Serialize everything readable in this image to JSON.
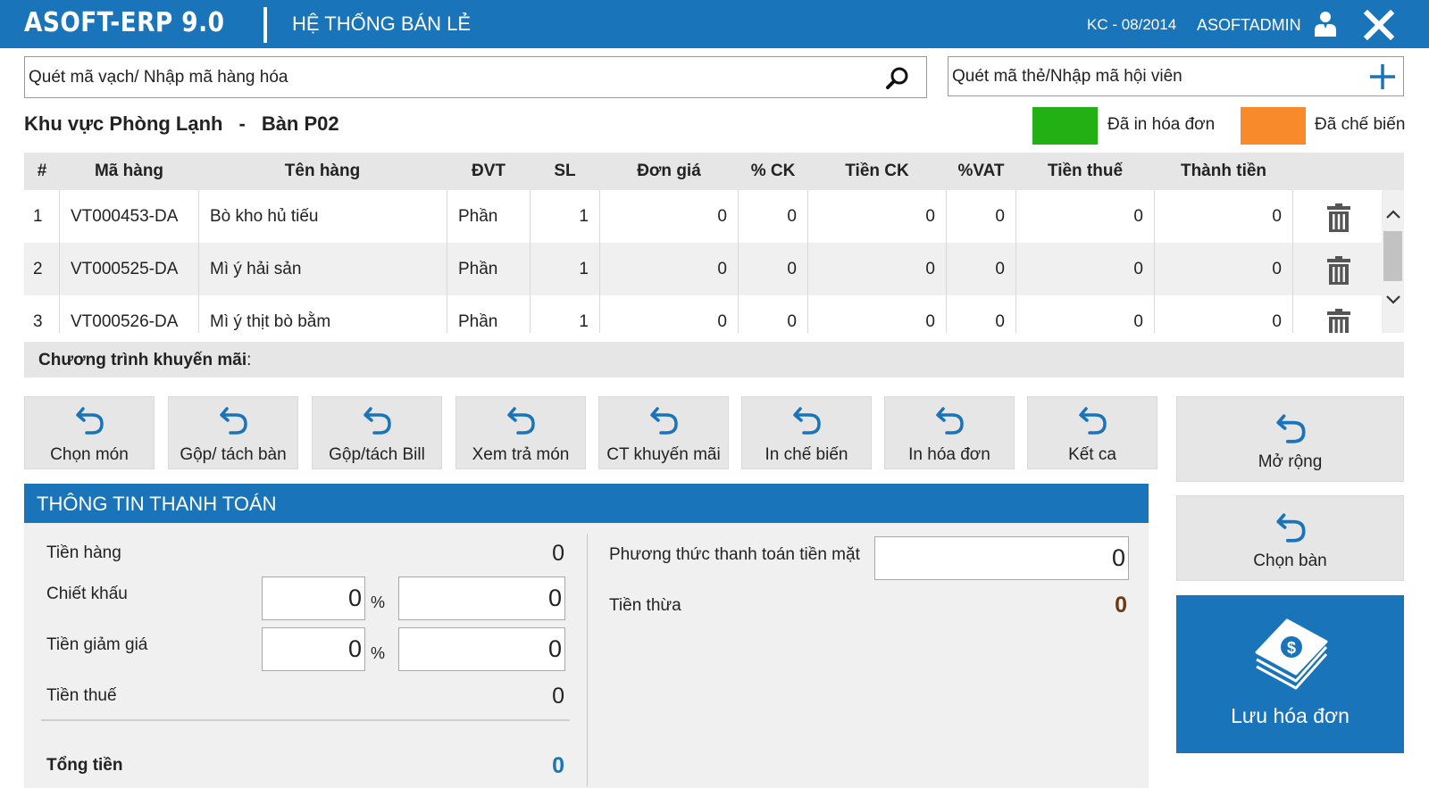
{
  "header": {
    "logo": "ASOFT-ERP 9.0",
    "system_title": "HỆ THỐNG BÁN LẺ",
    "period": "KC - 08/2014",
    "username": "ASOFTADMIN",
    "colors": {
      "primary": "#1a74b9"
    }
  },
  "search": {
    "product_placeholder": "Quét mã vạch/ Nhập mã hàng hóa",
    "member_placeholder": "Quét mã thẻ/Nhập mã hội viên"
  },
  "location": {
    "area": "Khu vực Phòng Lạnh",
    "separator": "-",
    "table": "Bàn P02"
  },
  "legend": {
    "printed_label": "Đã in hóa đơn",
    "printed_color": "#22b014",
    "processed_label": "Đã chế biến",
    "processed_color": "#f98a2c"
  },
  "table": {
    "columns": [
      "#",
      "Mã hàng",
      "Tên hàng",
      "ĐVT",
      "SL",
      "Đơn giá",
      "% CK",
      "Tiền CK",
      "%VAT",
      "Tiền thuế",
      "Thành tiền"
    ],
    "rows": [
      {
        "no": "1",
        "code": "VT000453-DA",
        "name": "Bò kho hủ tiếu",
        "unit": "Phần",
        "qty": "1",
        "price": "0",
        "discount_pct": "0",
        "discount_amt": "0",
        "vat_pct": "0",
        "tax_amt": "0",
        "total": "0"
      },
      {
        "no": "2",
        "code": "VT000525-DA",
        "name": "Mì ý hải sản",
        "unit": "Phần",
        "qty": "1",
        "price": "0",
        "discount_pct": "0",
        "discount_amt": "0",
        "vat_pct": "0",
        "tax_amt": "0",
        "total": "0"
      },
      {
        "no": "3",
        "code": "VT000526-DA",
        "name": "Mì ý thịt bò bằm",
        "unit": "Phần",
        "qty": "1",
        "price": "0",
        "discount_pct": "0",
        "discount_amt": "0",
        "vat_pct": "0",
        "tax_amt": "0",
        "total": "0"
      }
    ]
  },
  "promotion": {
    "label": "Chương trình khuyến mãi",
    "colon": ":"
  },
  "actions": [
    {
      "label": "Chọn món",
      "icon": "undo-arrow-icon"
    },
    {
      "label": "Gộp/ tách bàn",
      "icon": "undo-arrow-icon"
    },
    {
      "label": "Gộp/tách Bill",
      "icon": "undo-arrow-icon"
    },
    {
      "label": "Xem trả món",
      "icon": "undo-arrow-icon"
    },
    {
      "label": "CT khuyến mãi",
      "icon": "undo-arrow-icon"
    },
    {
      "label": "In chế biến",
      "icon": "undo-arrow-icon"
    },
    {
      "label": "In hóa đơn",
      "icon": "undo-arrow-icon"
    },
    {
      "label": "Kết ca",
      "icon": "undo-arrow-icon"
    }
  ],
  "side": {
    "expand_label": "Mở rộng",
    "choose_table_label": "Chọn bàn",
    "save_label": "Lưu hóa đơn"
  },
  "payment": {
    "title": "THÔNG TIN THANH TOÁN",
    "goods_label": "Tiền hàng",
    "goods_value": "0",
    "discount_label": "Chiết khấu",
    "discount_pct": "0",
    "discount_amt": "0",
    "reduction_label": "Tiền giảm giá",
    "reduction_pct": "0",
    "reduction_amt": "0",
    "pct_symbol": "%",
    "tax_label": "Tiền thuế",
    "tax_value": "0",
    "total_label": "Tổng tiền",
    "total_value": "0",
    "cash_method_label": "Phương thức thanh toán tiền mặt",
    "cash_value": "0",
    "change_label": "Tiền thừa",
    "change_value": "0"
  }
}
